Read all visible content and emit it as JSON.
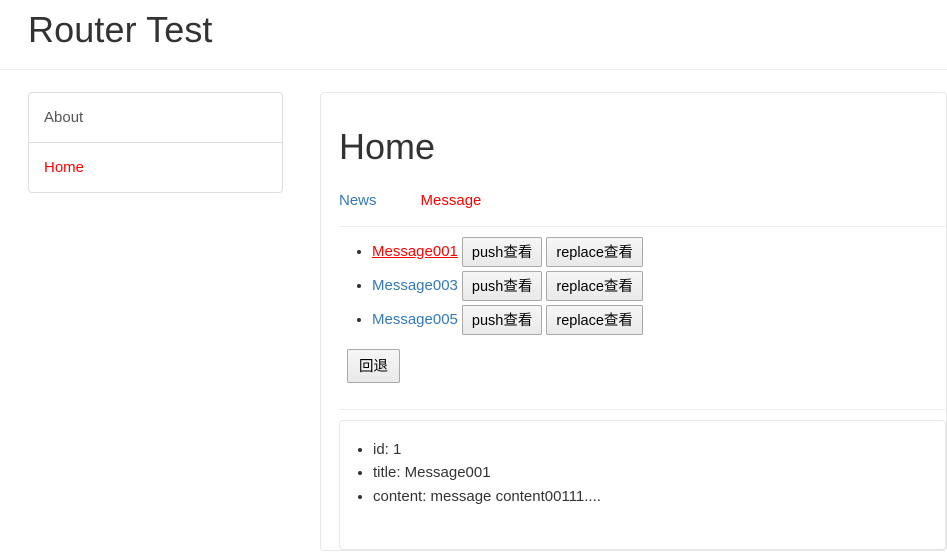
{
  "header": {
    "title": "Router Test"
  },
  "sidebar": {
    "items": [
      {
        "label": "About",
        "active": false
      },
      {
        "label": "Home",
        "active": true
      }
    ]
  },
  "main": {
    "title": "Home",
    "tabs": [
      {
        "label": "News",
        "active": false
      },
      {
        "label": "Message",
        "active": true
      }
    ],
    "messages": [
      {
        "link_label": "Message001",
        "active": true,
        "push_label": "push查看",
        "replace_label": "replace查看"
      },
      {
        "link_label": "Message003",
        "active": false,
        "push_label": "push查看",
        "replace_label": "replace查看"
      },
      {
        "link_label": "Message005",
        "active": false,
        "push_label": "push查看",
        "replace_label": "replace查看"
      }
    ],
    "back_button_label": "回退",
    "detail": [
      "id: 1",
      "title: Message001",
      "content: message content00111...."
    ]
  },
  "colors": {
    "link": "#337ab7",
    "active": "#ff0000",
    "text": "#333333",
    "border": "#dddddd",
    "rule": "#eeeeee"
  }
}
